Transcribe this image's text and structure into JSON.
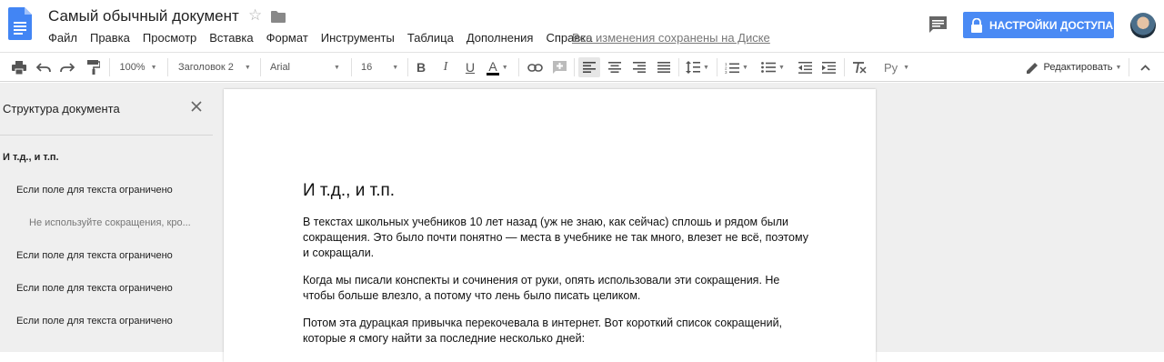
{
  "header": {
    "title": "Самый обычный документ",
    "menu": [
      "Файл",
      "Правка",
      "Просмотр",
      "Вставка",
      "Формат",
      "Инструменты",
      "Таблица",
      "Дополнения",
      "Справка"
    ],
    "saved_status": "Все изменения сохранены на Диске",
    "share_label": "НАСТРОЙКИ ДОСТУПА"
  },
  "toolbar": {
    "zoom": "100%",
    "style": "Заголовок 2",
    "font": "Arial",
    "size": "16",
    "bold": "B",
    "italic": "I",
    "underline": "U",
    "text_color": "A",
    "input_tools": "Ру",
    "mode": "Редактировать"
  },
  "outline": {
    "title": "Структура документа",
    "items": [
      {
        "level": 1,
        "text": "И т.д., и т.п."
      },
      {
        "level": 2,
        "text": "Если поле для текста ограничено"
      },
      {
        "level": 3,
        "text": "Не используйте сокращения, кро..."
      },
      {
        "level": 2,
        "text": "Если поле для текста ограничено"
      },
      {
        "level": 2,
        "text": "Если поле для текста ограничено"
      },
      {
        "level": 2,
        "text": "Если поле для текста ограничено"
      }
    ]
  },
  "document": {
    "heading": "И т.д., и т.п.",
    "paragraphs": [
      "В текстах школьных учебников 10 лет назад  (уж не знаю, как сейчас) сплошь и рядом были сокращения. Это было почти понятно — места в учебнике не так много, влезет не всё, поэтому и сокращали.",
      "Когда мы писали конспекты и сочинения от руки, опять использовали эти сокращения. Не чтобы больше влезло, а потому что лень было писать целиком.",
      "Потом эта дурацкая привычка перекочевала в интернет. Вот короткий список сокращений, которые я смогу найти за последние несколько дней:"
    ]
  },
  "colors": {
    "accent": "#4a8af4",
    "canvas": "#efefef",
    "doc_icon": "#4285f4"
  }
}
